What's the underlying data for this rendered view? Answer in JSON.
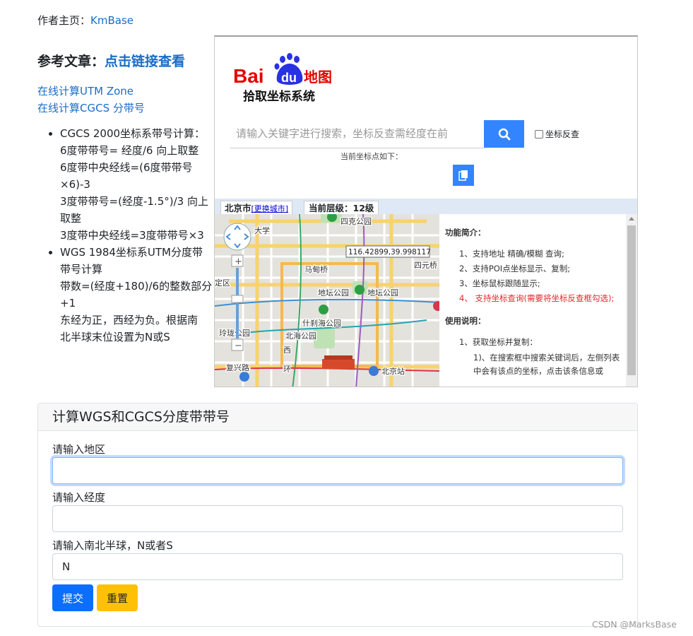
{
  "author": {
    "label": "作者主页：",
    "link": "KmBase"
  },
  "reference": {
    "title": "参考文章：",
    "title_link": "点击链接查看",
    "links": [
      "在线计算UTM Zone",
      "在线计算CGCS 分带号"
    ],
    "bullets": [
      {
        "lines": [
          "CGCS 2000坐标系带号计算：",
          "6度带带号= 经度/6 向上取整",
          "6度带中央经线=(6度带带号",
          "×6)-3",
          "3度带带号=(经度-1.5°)/3 向上",
          "取整",
          "3度带中央经线=3度带带号×3"
        ]
      },
      {
        "lines": [
          " WGS 1984坐标系UTM分度带",
          "带号计算",
          "带数=(经度+180)/6的整数部分",
          "+1",
          "东经为正，西经为负。根据南",
          "北半球末位设置为N或S"
        ]
      }
    ]
  },
  "baidu": {
    "logo_text": "Bai",
    "logo_du": "du",
    "logo_map": "地图",
    "subtitle": "拾取坐标系统",
    "search_placeholder": "请输入关键字进行搜索，坐标反查需经度在前",
    "reverse_label": "坐标反查",
    "current_label": "当前坐标点如下：",
    "city": "北京市",
    "change_city": "[更换城市]",
    "level": "当前层级：12级",
    "coord_readout": "116.42899,39.998117",
    "map_labels": [
      "四克公园",
      "马甸桥",
      "四元桥",
      "地坛公园",
      "地坛公园",
      "什刹海公园",
      "北海公园",
      "玲珑公园",
      "复兴路",
      "西",
      "环",
      "北京站",
      "定区",
      "大学"
    ],
    "info": {
      "intro_title": "功能简介：",
      "intro_items": [
        "1、支持地址 精确/模糊 查询;",
        "2、支持POI点坐标显示、复制;",
        "3、坐标鼠标跟随显示;"
      ],
      "intro_red": "4、 支持坐标查询(需要将坐标反查框勾选);",
      "usage_title": "使用说明：",
      "usage_items": [
        "1、获取坐标并复制："
      ],
      "usage_sub": "1)、在搜索框中搜索关键词后，左侧列表中会有该点的坐标，点击该条信息或"
    }
  },
  "form": {
    "title": "计算WGS和CGCS分度带带号",
    "region_label": "请输入地区",
    "region_value": "",
    "lon_label": "请输入经度",
    "lon_value": "",
    "hemi_label": "请输入南北半球，N或者S",
    "hemi_value": "N",
    "submit": "提交",
    "reset": "重置"
  },
  "watermark": "CSDN @MarksBase",
  "colors": {
    "link": "#1a6cc8",
    "primary": "#0d6efd",
    "warning": "#ffc107",
    "baidu_blue": "#3385ff",
    "baidu_red": "#e10601"
  }
}
